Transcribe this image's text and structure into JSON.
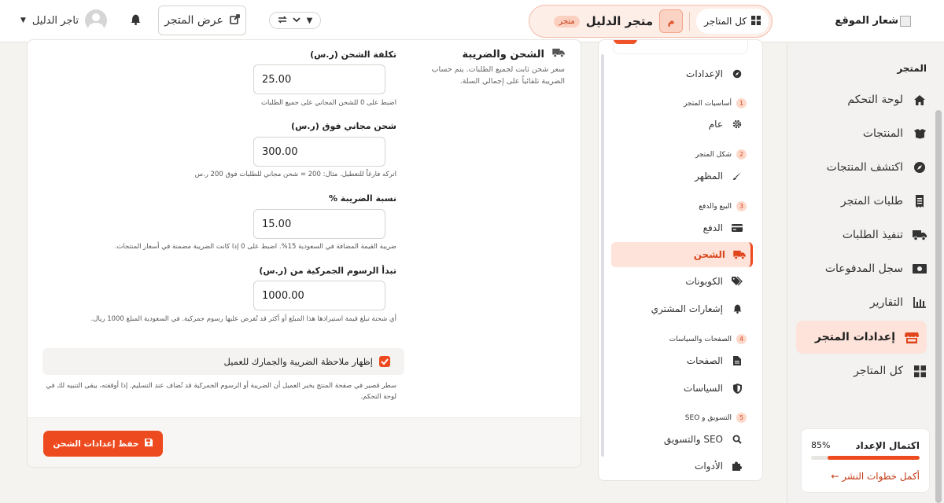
{
  "sidebar": {
    "logo_text": "شعار الموقع",
    "section_title": "المتجر",
    "items": [
      {
        "label": "لوحة التحكم",
        "icon": "home-icon"
      },
      {
        "label": "المنتجات",
        "icon": "boxes-icon"
      },
      {
        "label": "اكتشف المنتجات",
        "icon": "compass-icon"
      },
      {
        "label": "طلبات المتجر",
        "icon": "receipt-icon"
      },
      {
        "label": "تنفيذ الطلبات",
        "icon": "truck-icon"
      },
      {
        "label": "سجل المدفوعات",
        "icon": "money-icon"
      },
      {
        "label": "التقارير",
        "icon": "chart-icon"
      },
      {
        "label": "إعدادات المتجر",
        "icon": "store-icon",
        "active": true
      },
      {
        "label": "كل المتاجر",
        "icon": "grid-icon"
      }
    ],
    "setup": {
      "title": "اكتمال الإعداد",
      "percent_label": "85%",
      "progress": 0.85,
      "link": "أكمل خطوات النشر ←"
    }
  },
  "topbar": {
    "all_stores": "كل المتاجر",
    "store_initial": "م",
    "store_name": "متجر الدليل",
    "store_tag": "متجر",
    "view_store": "عرض المتجر",
    "user_name": "تاجر الدليل"
  },
  "settings_nav": {
    "items": [
      {
        "type": "item",
        "label": "الإعدادات",
        "icon": "compass-icon"
      },
      {
        "type": "group",
        "num": "1",
        "label": "أساسيات المتجر"
      },
      {
        "type": "item",
        "label": "عام",
        "icon": "gear-icon"
      },
      {
        "type": "group",
        "num": "2",
        "label": "شكل المتجر"
      },
      {
        "type": "item",
        "label": "المظهر",
        "icon": "brush-icon"
      },
      {
        "type": "group",
        "num": "3",
        "label": "البيع والدفع"
      },
      {
        "type": "item",
        "label": "الدفع",
        "icon": "card-icon"
      },
      {
        "type": "item",
        "label": "الشحن",
        "icon": "truck-icon",
        "active": true
      },
      {
        "type": "item",
        "label": "الكوبونات",
        "icon": "tags-icon"
      },
      {
        "type": "item",
        "label": "إشعارات المشتري",
        "icon": "bell-icon"
      },
      {
        "type": "group",
        "num": "4",
        "label": "الصفحات والسياسات"
      },
      {
        "type": "item",
        "label": "الصفحات",
        "icon": "file-icon"
      },
      {
        "type": "item",
        "label": "السياسات",
        "icon": "shield-icon"
      },
      {
        "type": "group",
        "num": "5",
        "label": "التسويق و SEO"
      },
      {
        "type": "item",
        "label": "SEO والتسويق",
        "icon": "search-icon"
      },
      {
        "type": "item",
        "label": "الأدوات",
        "icon": "puzzle-icon"
      }
    ]
  },
  "shipping": {
    "title": "الشحن والضريبة",
    "description": "سعر شحن ثابت لجميع الطلبات. يتم حساب الضريبة تلقائياً على إجمالي السلة.",
    "fields": [
      {
        "label": "تكلفة الشحن (ر.س)",
        "value": "25.00",
        "help": "اضبط على 0 للشحن المجاني على جميع الطلبات"
      },
      {
        "label": "شحن مجاني فوق (ر.س)",
        "value": "300.00",
        "help": "اتركه فارغاً للتعطيل. مثال: 200 = شحن مجاني للطلبات فوق 200 ر.س"
      },
      {
        "label": "نسبة الضريبة %",
        "value": "15.00",
        "help": "ضريبة القيمة المضافة في السعودية 15%. اضبط على 0 إذا كانت الضريبة مضمنة في أسعار المنتجات."
      },
      {
        "label": "تبدأ الرسوم الجمركية من (ر.س)",
        "value": "1000.00",
        "help": "أي شحنة تبلغ قيمة استيرادها هذا المبلغ أو أكثر قد تُفرض عليها رسوم جمركية. في السعودية المبلغ 1000 ريال."
      }
    ],
    "checkbox_label": "إظهار ملاحظة الضريبة والجمارك للعميل",
    "checkbox_checked": true,
    "checkbox_help": "سطر قصير في صفحة المنتج يخبر العميل أن الضريبة أو الرسوم الجمركية قد تُضاف عند التسليم. إذا أوقفته، يبقى التنبيه لك في لوحة التحكم.",
    "save_label": "حفظ إعدادات الشحن"
  },
  "colors": {
    "accent": "#ee4a1f",
    "accent_soft": "#fde3da"
  }
}
